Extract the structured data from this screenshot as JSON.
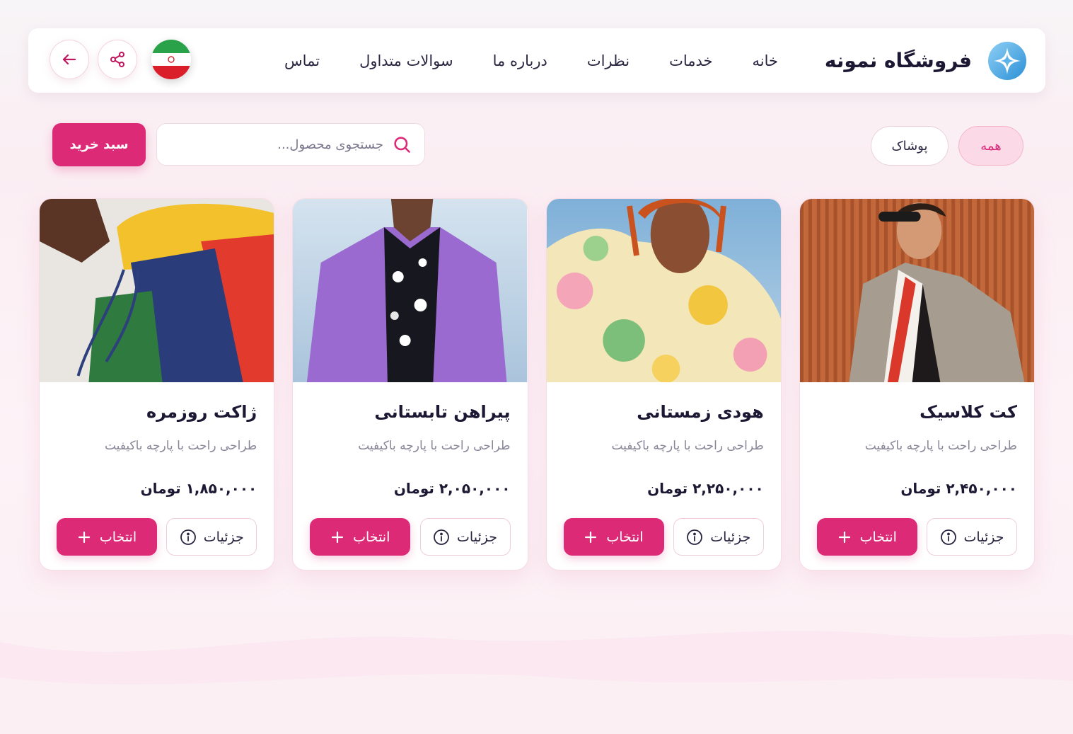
{
  "brand": {
    "name": "فروشگاه نمونه",
    "logo_icon": "sparkle-logo-icon"
  },
  "nav": [
    {
      "id": "home",
      "label": "خانه"
    },
    {
      "id": "services",
      "label": "خدمات"
    },
    {
      "id": "reviews",
      "label": "نظرات"
    },
    {
      "id": "about",
      "label": "درباره ما"
    },
    {
      "id": "faq",
      "label": "سوالات متداول"
    },
    {
      "id": "contact",
      "label": "تماس"
    }
  ],
  "header_actions": {
    "language_flag": "iran-flag-icon",
    "share_icon": "share-icon",
    "back_icon": "arrow-left-icon"
  },
  "filters": [
    {
      "label": "همه",
      "active": true
    },
    {
      "label": "پوشاک",
      "active": false
    }
  ],
  "search": {
    "placeholder": "جستجوی محصول..."
  },
  "cart": {
    "label": "سبد خرید"
  },
  "colors": {
    "accent": "#dc2a77",
    "accent_soft": "#fbd9e6",
    "text": "#1c1733",
    "muted": "#8a8598"
  },
  "products": [
    {
      "title": "ژاکت روزمره",
      "description": "طراحی راحت با پارچه باکیفیت",
      "price": "۱,۸۵۰,۰۰۰ تومان",
      "select_label": "انتخاب",
      "details_label": "جزئیات",
      "image": "colorblock-jacket-photo"
    },
    {
      "title": "پیراهن تابستانی",
      "description": "طراحی راحت با پارچه باکیفیت",
      "price": "۲,۰۵۰,۰۰۰ تومان",
      "select_label": "انتخاب",
      "details_label": "جزئیات",
      "image": "purple-blazer-floral-shirt-photo"
    },
    {
      "title": "هودی زمستانی",
      "description": "طراحی راحت با پارچه باکیفیت",
      "price": "۲,۲۵۰,۰۰۰ تومان",
      "select_label": "انتخاب",
      "details_label": "جزئیات",
      "image": "floral-puffer-jacket-photo"
    },
    {
      "title": "کت کلاسیک",
      "description": "طراحی راحت با پارچه باکیفیت",
      "price": "۲,۴۵۰,۰۰۰ تومان",
      "select_label": "انتخاب",
      "details_label": "جزئیات",
      "image": "classic-suit-photo"
    }
  ]
}
